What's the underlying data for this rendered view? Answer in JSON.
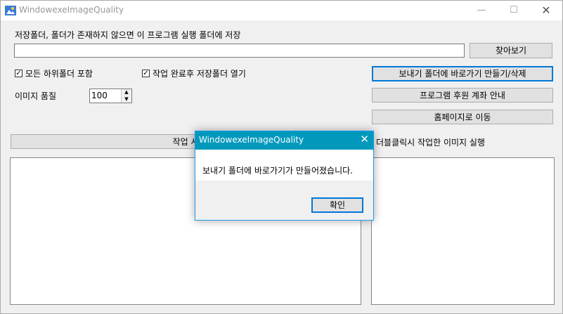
{
  "window": {
    "title": "WindowexeImageQuality",
    "controls": {
      "minimize": "—",
      "maximize": "☐",
      "close": "✕"
    }
  },
  "save_folder": {
    "label": "저장폴더, 폴더가 존재하지 않으면 이 프로그램 실행 폴더에 저장",
    "value": "",
    "browse_button": "찾아보기"
  },
  "options": {
    "include_subfolders": {
      "label": "모든 하위폴더 포함",
      "checked": true
    },
    "open_after_done": {
      "label": "작업 완료후 저장폴더 열기",
      "checked": true
    }
  },
  "quality": {
    "label": "이미지 품질",
    "value": "100"
  },
  "buttons": {
    "shortcut": "보내기 폴더에 바로가기 만들기/삭제",
    "donate": "프로그램 후원 계좌 안내",
    "homepage": "홈페이지로 이동"
  },
  "work_header": "작업 시",
  "right_header": "더블클릭시 작업한 이미지 실행",
  "dialog": {
    "title": "WindowexeImageQuality",
    "message": "보내기 폴더에 바로가기가 만들어졌습니다.",
    "ok": "확인"
  }
}
